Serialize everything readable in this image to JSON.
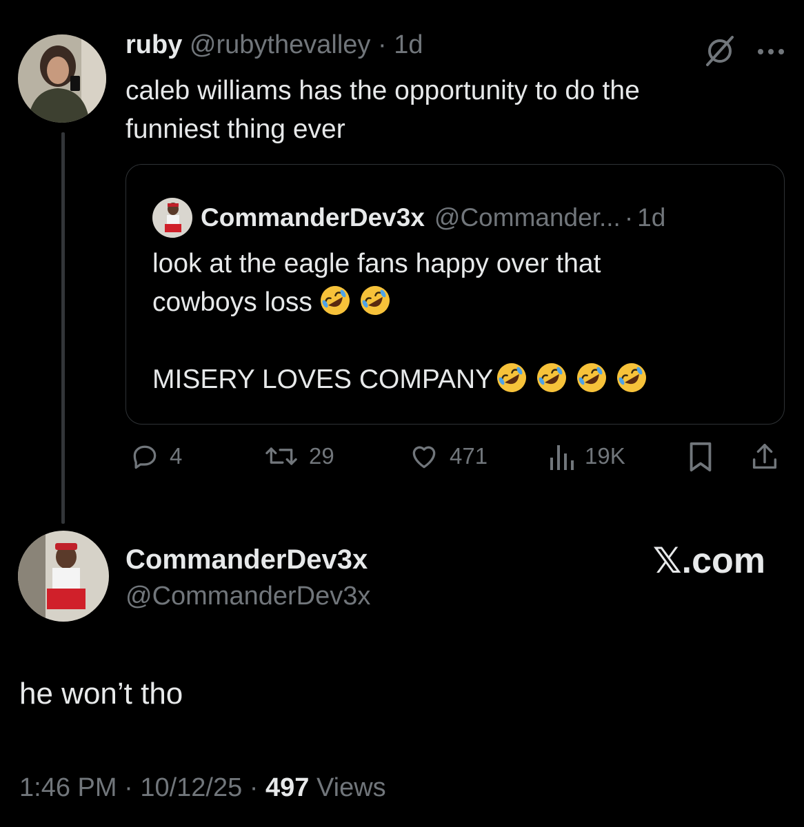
{
  "parent_tweet": {
    "display_name": "ruby",
    "handle": "@rubythevalley",
    "separator": "·",
    "time": "1d",
    "text_line1": "caleb williams has the opportunity to do the",
    "text_line2": "funniest thing ever"
  },
  "quoted_tweet": {
    "display_name": "CommanderDev3x",
    "handle": "@Commander...",
    "separator": "·",
    "time": "1d",
    "line1": "look at the eagle fans happy over that",
    "line2": "cowboys loss",
    "line3": "MISERY LOVES COMPANY",
    "emoji": "rolling-on-floor-laughing"
  },
  "actions": {
    "replies": "4",
    "reposts": "29",
    "likes": "471",
    "views": "19K"
  },
  "reply": {
    "display_name": "CommanderDev3x",
    "handle": "@CommanderDev3x",
    "brand": "𝕏.com",
    "text": "he won’t tho",
    "time": "1:46 PM",
    "separator1": "·",
    "date": "10/12/25",
    "separator2": "·",
    "view_count": "497",
    "views_label": "Views"
  },
  "colors": {
    "background": "#000000",
    "text_primary": "#e7e9ea",
    "text_secondary": "#71767b",
    "border": "#2f3336"
  }
}
